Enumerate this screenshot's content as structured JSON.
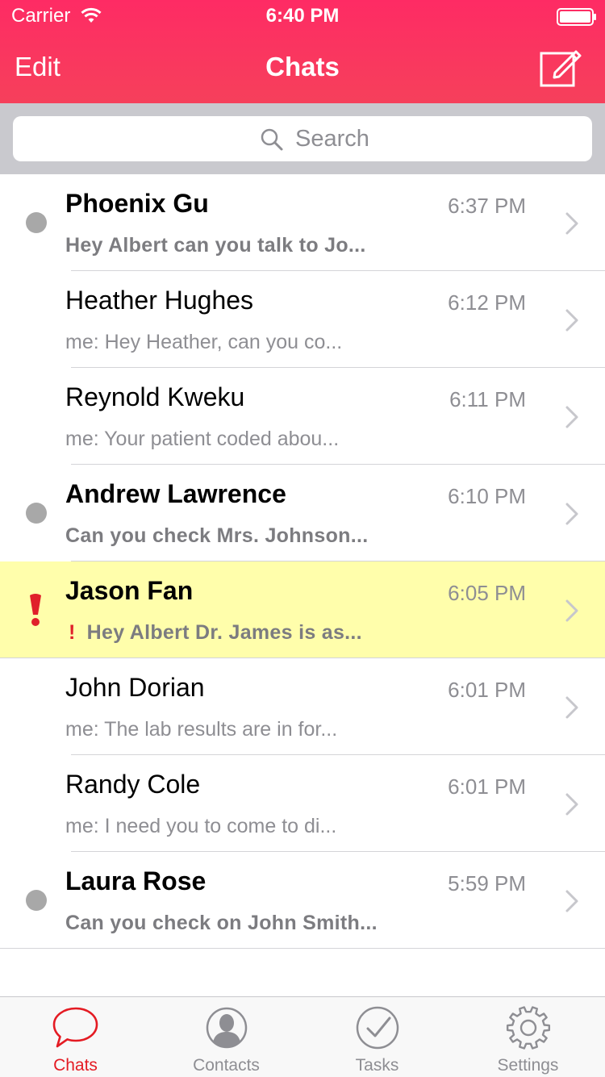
{
  "status_bar": {
    "carrier": "Carrier",
    "time": "6:40 PM"
  },
  "nav": {
    "edit_label": "Edit",
    "title": "Chats"
  },
  "search": {
    "placeholder": "Search"
  },
  "chats": [
    {
      "name": "Phoenix Gu",
      "time": "6:37 PM",
      "preview": "Hey Albert can you talk to Jo...",
      "unread": true,
      "urgent": false
    },
    {
      "name": "Heather Hughes",
      "time": "6:12 PM",
      "preview": "me: Hey Heather, can you co...",
      "unread": false,
      "urgent": false
    },
    {
      "name": "Reynold Kweku",
      "time": "6:11 PM",
      "preview": "me: Your patient coded abou...",
      "unread": false,
      "urgent": false
    },
    {
      "name": "Andrew Lawrence",
      "time": "6:10 PM",
      "preview": "Can you check Mrs. Johnson...",
      "unread": true,
      "urgent": false
    },
    {
      "name": "Jason Fan",
      "time": "6:05 PM",
      "preview": "Hey Albert Dr. James is as...",
      "unread": true,
      "urgent": true
    },
    {
      "name": "John Dorian",
      "time": "6:01 PM",
      "preview": "me: The lab results are in for...",
      "unread": false,
      "urgent": false
    },
    {
      "name": "Randy Cole",
      "time": "6:01 PM",
      "preview": "me: I need you to come to di...",
      "unread": false,
      "urgent": false
    },
    {
      "name": "Laura Rose",
      "time": "5:59 PM",
      "preview": "Can you check on John Smith...",
      "unread": true,
      "urgent": false
    }
  ],
  "urgent_mark": "!",
  "tabs": [
    {
      "label": "Chats",
      "icon": "chat-bubble-icon",
      "active": true
    },
    {
      "label": "Contacts",
      "icon": "contact-icon",
      "active": false
    },
    {
      "label": "Tasks",
      "icon": "checkmark-circle-icon",
      "active": false
    },
    {
      "label": "Settings",
      "icon": "gear-icon",
      "active": false
    }
  ],
  "colors": {
    "header_top": "#fe2b64",
    "header_bottom": "#f6405b",
    "urgent_row": "#fffeab",
    "urgent_red": "#e0202a",
    "active_tab": "#e41b23",
    "inactive_tab": "#8e8e93",
    "unread_dot": "#a8a8a8"
  }
}
